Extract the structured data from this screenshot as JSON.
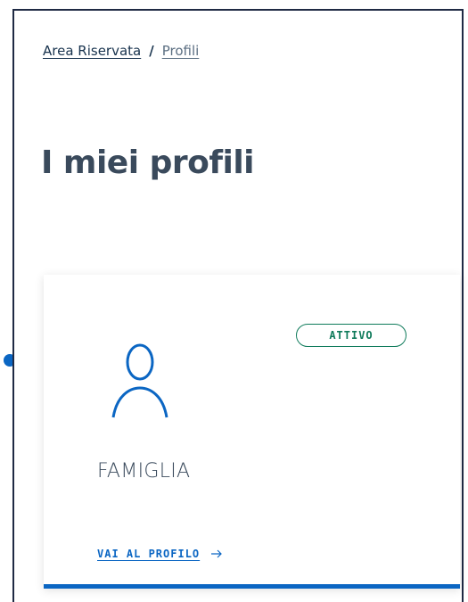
{
  "breadcrumb": {
    "parent": "Area Riservata",
    "separator": "/",
    "current": "Profili"
  },
  "page": {
    "title": "I miei profili"
  },
  "profiles": [
    {
      "status": "ATTIVO",
      "name": "FAMIGLIA",
      "icon": "user-icon",
      "link_label": "VAI AL PROFILO",
      "link_icon": "arrow-right-icon"
    }
  ],
  "colors": {
    "accent": "#0b66c3",
    "status_active": "#0e7a5a",
    "text_dark": "#17324d",
    "title": "#3a4a5c"
  }
}
